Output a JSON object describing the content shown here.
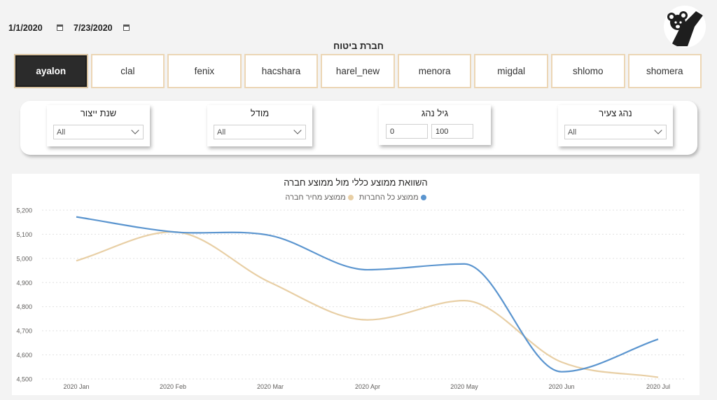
{
  "date_range": {
    "start": "1/1/2020",
    "end": "7/23/2020"
  },
  "company_slicer": {
    "title": "חברת ביטוח",
    "companies": [
      "ayalon",
      "clal",
      "fenix",
      "hacshara",
      "harel_new",
      "menora",
      "migdal",
      "shlomo",
      "shomera"
    ],
    "selected": "ayalon"
  },
  "filters": {
    "year": {
      "title": "שנת ייצור",
      "value": "All"
    },
    "model": {
      "title": "מודל",
      "value": "All"
    },
    "driver_age": {
      "title": "גיל נהג",
      "min": "0",
      "max": "100"
    },
    "young_driver": {
      "title": "נהג צעיר",
      "value": "All"
    }
  },
  "colors": {
    "all_companies": "#5b95cf",
    "company": "#e8cfa5",
    "selected_tab": "#2b2b2b",
    "tab_border": "#ecd6b5"
  },
  "icons": {
    "logo": "koala-logo-icon",
    "calendar": "calendar-icon",
    "dropdown": "chevron-down-icon"
  },
  "chart_data": {
    "type": "line",
    "title": "השוואת ממוצע כללי מול ממוצע חברה",
    "categories": [
      "2020 Jan",
      "2020 Feb",
      "2020 Mar",
      "2020 Apr",
      "2020 May",
      "2020 Jun",
      "2020 Jul"
    ],
    "series": [
      {
        "name": "ממוצע כל החברות",
        "color": "#5b95cf",
        "values": [
          5172,
          5110,
          5095,
          4953,
          4977,
          4530,
          4665
        ]
      },
      {
        "name": "ממוצע מחיר חברה",
        "color": "#e8cfa5",
        "values": [
          4990,
          5110,
          4900,
          4745,
          4825,
          4570,
          4507
        ]
      }
    ],
    "ylim": [
      4500,
      5200
    ],
    "yticks": [
      "4,500",
      "4,600",
      "4,700",
      "4,800",
      "4,900",
      "5,000",
      "5,100",
      "5,200"
    ],
    "grid": true,
    "legend": "top-center"
  }
}
